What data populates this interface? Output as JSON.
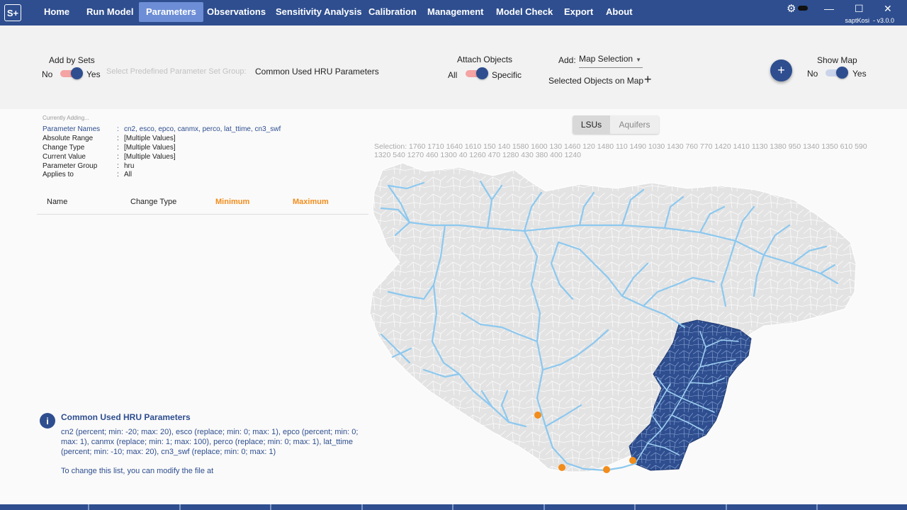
{
  "app": {
    "logo": "S+",
    "user": "saptKosi",
    "version": "v3.0.0"
  },
  "nav": [
    "Home",
    "Run Model",
    "Parameters",
    "Observations",
    "Sensitivity Analysis",
    "Calibration",
    "Management",
    "Model Check",
    "Export",
    "About"
  ],
  "nav_active": "Parameters",
  "window_controls": {
    "minimize": "—",
    "maximize": "☐",
    "close": "✕"
  },
  "toolbar": {
    "add_by_sets": {
      "label": "Add by Sets",
      "off": "No",
      "on": "Yes",
      "value": true
    },
    "predefined_label": "Select Predefined Parameter Set Group:",
    "predefined_value": "Common Used HRU Parameters",
    "attach_objects": {
      "label": "Attach Objects",
      "off": "All",
      "on": "Specific",
      "value": true
    },
    "add_label": "Add:",
    "add_value": "Map Selection",
    "selected_objects": "Selected Objects on Map",
    "show_map": {
      "label": "Show Map",
      "off": "No",
      "on": "Yes",
      "value": true
    },
    "add_button": "+"
  },
  "current": {
    "heading": "Currently Adding...",
    "rows": [
      {
        "key": "Parameter Names",
        "value": "cn2, esco, epco, canmx, perco, lat_ttime, cn3_swf"
      },
      {
        "key": "Absolute Range",
        "value": "[Multiple Values]"
      },
      {
        "key": "Change Type",
        "value": "[Multiple Values]"
      },
      {
        "key": "Current Value",
        "value": "[Multiple Values]"
      },
      {
        "key": "Parameter Group",
        "value": "hru"
      },
      {
        "key": "Applies to",
        "value": "All"
      }
    ]
  },
  "table": {
    "columns": [
      "Name",
      "Change Type",
      "Minimum",
      "Maximum"
    ]
  },
  "info": {
    "title": "Common Used HRU Parameters",
    "text": "cn2 (percent; min: -20; max: 20), esco (replace; min: 0; max: 1), epco (percent; min: 0; max: 1), canmx (replace; min: 1; max: 100), perco (replace; min: 0; max: 1), lat_ttime (percent; min: -10; max: 20), cn3_swf (replace; min: 0; max: 1)",
    "footer": "To change this list, you can modify the file at"
  },
  "map": {
    "tabs": [
      "LSUs",
      "Aquifers"
    ],
    "active_tab": "LSUs",
    "selection": "Selection: 1760 1710 1640 1610 150 140 1580 1600 130 1460 120 1480 110 1490 1030 1430 760 770 1420 1410 1130 1380 950 1340 1350 610 590 1320 540 1270 460 1300 40 1260 470 1280 430 380 400 1240",
    "colors": {
      "land": "#e3e3e3",
      "river": "#8cc8ef",
      "selected": "#2e4e8f",
      "outlet": "#f28c1a"
    }
  },
  "colors": {
    "primary": "#2e4e8f",
    "accent": "#f28c1a",
    "toggle_track": "#f5a3a3"
  }
}
